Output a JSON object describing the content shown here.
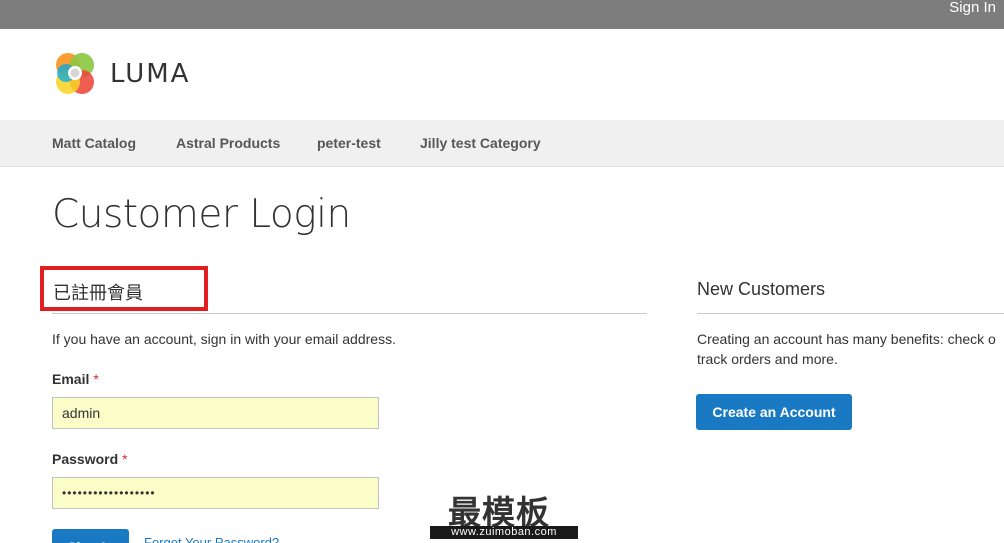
{
  "topbar": {
    "signin_label": "Sign In"
  },
  "header": {
    "brand": "LUMA",
    "logo_icon": "luma-logo-icon"
  },
  "nav": {
    "items": [
      {
        "label": "Matt Catalog"
      },
      {
        "label": "Astral Products"
      },
      {
        "label": "peter-test"
      },
      {
        "label": "Jilly test Category"
      }
    ]
  },
  "page": {
    "title": "Customer Login"
  },
  "login": {
    "title": "已註冊會員",
    "note": "If you have an account, sign in with your email address.",
    "email_label": "Email",
    "email_value": "admin",
    "password_label": "Password",
    "password_value": "••••••••••••••••••",
    "required_mark": "*",
    "signin_button": "Sign In",
    "forgot_link": "Forgot Your Password?"
  },
  "new_customers": {
    "title": "New Customers",
    "note_line1": "Creating an account has many benefits: check o",
    "note_line2": "track orders and more.",
    "create_button": "Create an Account"
  },
  "watermark": {
    "big": "最模板",
    "small": "www.zuimoban.com"
  },
  "colors": {
    "topbar": "#7d7d7d",
    "nav_bg": "#f0f0f0",
    "accent": "#1979c3",
    "input_autofill": "#fafdc8",
    "highlight": "#e02020",
    "required": "#e02b27"
  }
}
